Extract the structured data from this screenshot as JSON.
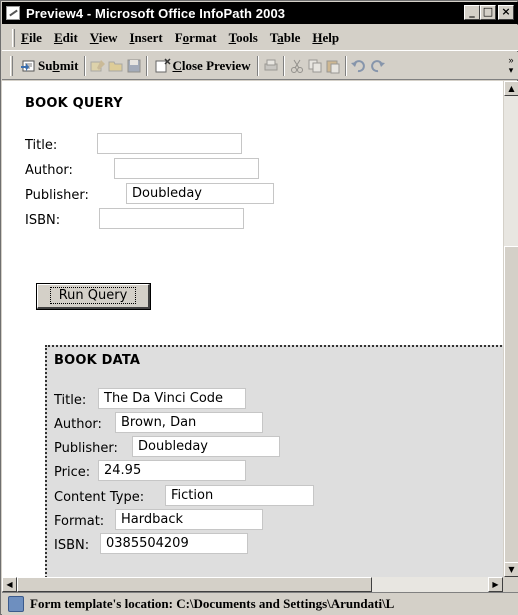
{
  "window": {
    "title": "Preview4 - Microsoft Office InfoPath 2003",
    "buttons": {
      "minimize": "_",
      "maximize": "□",
      "close": "×"
    }
  },
  "menu": {
    "items": [
      {
        "label_ul": "F",
        "label_rest": "ile"
      },
      {
        "label_ul": "E",
        "label_rest": "dit"
      },
      {
        "label_ul": "V",
        "label_rest": "iew"
      },
      {
        "label_ul": "I",
        "label_rest": "nsert"
      },
      {
        "label_pre": "F",
        "label_ul": "o",
        "label_rest": "rmat"
      },
      {
        "label_ul": "T",
        "label_rest": "ools"
      },
      {
        "label_pre": "T",
        "label_ul": "a",
        "label_rest": "ble"
      },
      {
        "label_ul": "H",
        "label_rest": "elp"
      }
    ]
  },
  "toolbar": {
    "submit_pre": "Su",
    "submit_ul": "b",
    "submit_rest": "mit",
    "close_preview_ul": "C",
    "close_preview_rest": "lose Preview",
    "icons": [
      "submit-icon",
      "insert-field-icon",
      "open-icon",
      "save-icon",
      "close-preview-icon",
      "print-icon",
      "cut-icon",
      "copy-icon",
      "paste-icon",
      "undo-icon",
      "redo-icon"
    ]
  },
  "query": {
    "title": "BOOK QUERY",
    "fields": [
      {
        "label": "Title:",
        "value": ""
      },
      {
        "label": "Author:",
        "value": ""
      },
      {
        "label": "Publisher:",
        "value": "Doubleday"
      },
      {
        "label": "ISBN:",
        "value": ""
      }
    ],
    "button_label": "Run Query"
  },
  "data": {
    "title": "BOOK DATA",
    "fields": [
      {
        "label": "Title:",
        "value": "The Da Vinci Code"
      },
      {
        "label": "Author:",
        "value": "Brown, Dan"
      },
      {
        "label": "Publisher:",
        "value": "Doubleday"
      },
      {
        "label": "Price:",
        "value": "24.95"
      },
      {
        "label": "Content Type:",
        "value": "Fiction"
      },
      {
        "label": "Format:",
        "value": "Hardback"
      },
      {
        "label": "ISBN:",
        "value": "0385504209"
      }
    ]
  },
  "status": {
    "text": "Form template's location: C:\\Documents and Settings\\Arundati\\L"
  }
}
